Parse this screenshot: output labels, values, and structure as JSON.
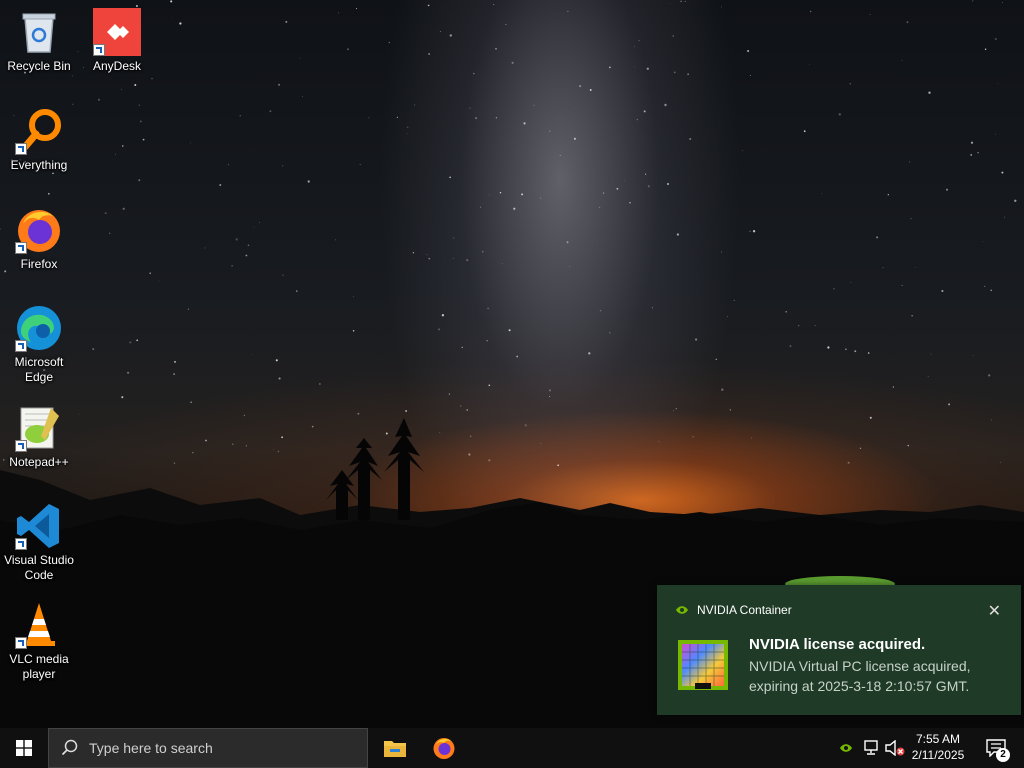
{
  "desktop": {
    "icons": [
      {
        "label": "Recycle Bin",
        "icon": "recycle-bin-icon"
      },
      {
        "label": "AnyDesk",
        "icon": "anydesk-icon"
      },
      {
        "label": "Everything",
        "icon": "everything-search-icon"
      },
      {
        "label": "Firefox",
        "icon": "firefox-icon"
      },
      {
        "label": "Microsoft Edge",
        "icon": "edge-icon"
      },
      {
        "label": "Notepad++",
        "icon": "notepadpp-icon"
      },
      {
        "label": "Visual Studio Code",
        "icon": "vscode-icon"
      },
      {
        "label": "VLC media player",
        "icon": "vlc-icon"
      }
    ]
  },
  "notification": {
    "app_name": "NVIDIA Container",
    "title": "NVIDIA license acquired.",
    "body": "NVIDIA Virtual PC license acquired, expiring at 2025-3-18 2:10:57 GMT.",
    "close_glyph": "✕",
    "accent": "#76b900"
  },
  "taskbar": {
    "search_placeholder": "Type here to search",
    "pinned": [
      {
        "name": "File Explorer",
        "icon": "file-explorer-icon"
      },
      {
        "name": "Firefox",
        "icon": "firefox-icon"
      }
    ],
    "tray": {
      "time": "7:55 AM",
      "date": "2/11/2025",
      "notification_count": "2"
    }
  }
}
